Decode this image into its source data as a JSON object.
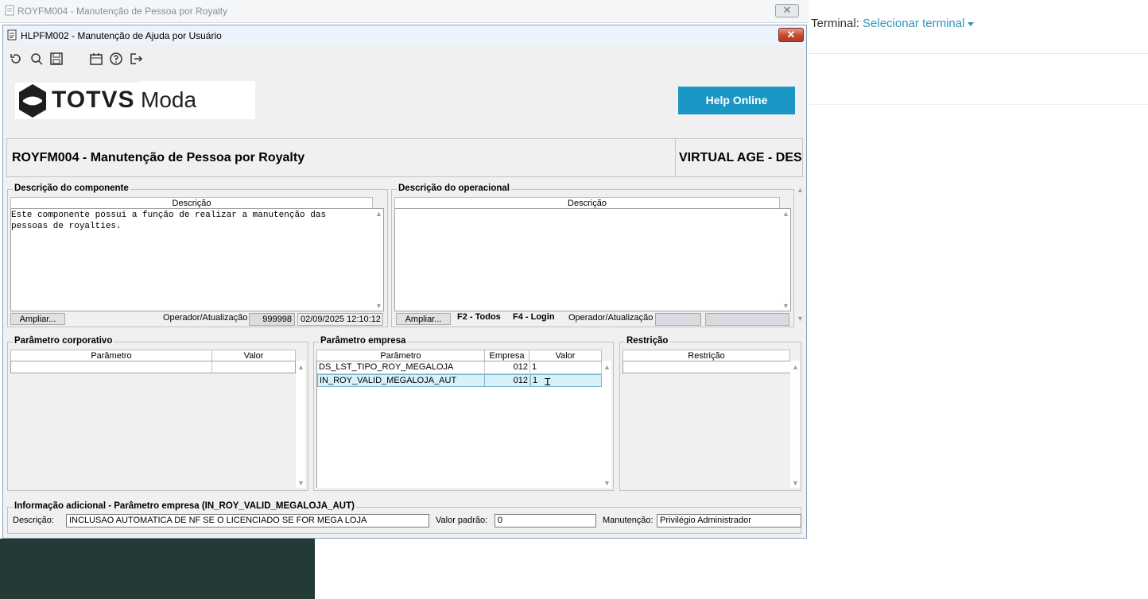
{
  "background": {
    "terminal_label": "Terminal:",
    "terminal_link": "Selecionar terminal"
  },
  "back_window": {
    "title": "ROYFM004 - Manutenção de Pessoa por Royalty"
  },
  "window": {
    "title": "HLPFM002 - Manutenção de Ajuda por Usuário",
    "close_symbol": "✕",
    "toolbar": [
      "undo-icon",
      "search-icon",
      "save-icon",
      "calendar-icon",
      "help-icon",
      "exit-icon"
    ],
    "brand": {
      "logo": "TOTVS",
      "product": "Moda"
    },
    "help_button": "Help Online",
    "header": {
      "component": "ROYFM004 - Manutenção de Pessoa por Royalty",
      "environment": "VIRTUAL AGE - DES"
    },
    "componente": {
      "legend": "Descrição do componente",
      "column": "Descrição",
      "text_line1": "Este componente possui a função de realizar a manutenção das",
      "text_line2": "pessoas de royalties.",
      "expand_button": "Ampliar...",
      "operator_label": "Operador/Atualização",
      "operator_value": "999998",
      "updated_value": "02/09/2025 12:10:12"
    },
    "operacional": {
      "legend": "Descrição do operacional",
      "column": "Descrição",
      "expand_button": "Ampliar...",
      "key_all": "F2 - Todos",
      "key_login": "F4 - Login",
      "operator_label": "Operador/Atualização",
      "operator_value": "",
      "updated_value": ""
    },
    "param_corp": {
      "legend": "Parâmetro corporativo",
      "columns": [
        "Parâmetro",
        "Valor"
      ]
    },
    "param_empresa": {
      "legend": "Parâmetro empresa",
      "columns": [
        "Parâmetro",
        "Empresa",
        "Valor"
      ],
      "rows": [
        {
          "param": "DS_LST_TIPO_ROY_MEGALOJA",
          "empresa": "012",
          "valor": "1"
        },
        {
          "param": "IN_ROY_VALID_MEGALOJA_AUT",
          "empresa": "012",
          "valor": "1"
        }
      ]
    },
    "restricao": {
      "legend": "Restrição",
      "column": "Restrição"
    },
    "info": {
      "legend": "Informação adicional - Parâmetro empresa (IN_ROY_VALID_MEGALOJA_AUT)",
      "desc_label": "Descrição:",
      "desc_value": "INCLUSAO AUTOMATICA DE NF SE O LICENCIADO SE FOR MEGA LOJA",
      "default_label": "Valor padrão:",
      "default_value": "0",
      "maint_label": "Manutenção:",
      "maint_value": "Privilégio Administrador"
    }
  }
}
